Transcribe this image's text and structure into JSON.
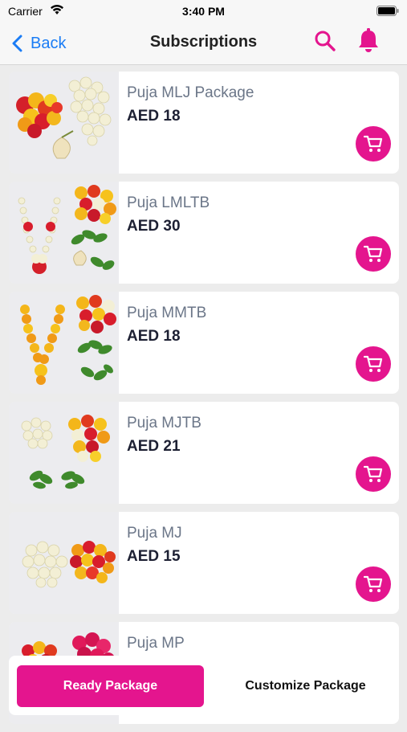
{
  "status_bar": {
    "carrier": "Carrier",
    "time": "3:40 PM",
    "icons": [
      "wifi-icon",
      "battery-icon"
    ]
  },
  "nav": {
    "back_label": "Back",
    "title": "Subscriptions",
    "icons": [
      "back-chevron-icon",
      "search-icon",
      "bell-icon"
    ]
  },
  "colors": {
    "accent": "#e4158e",
    "link": "#1a7cf5",
    "product_name": "#6b7688",
    "price": "#1d2033"
  },
  "products": [
    {
      "name": "Puja MLJ Package",
      "price": "AED 18",
      "image": "marigold-jasmine-lotus-bud"
    },
    {
      "name": "Puja LMLTB",
      "price": "AED 30",
      "image": "jasmine-garland-flowers-leaves"
    },
    {
      "name": "Puja MMTB",
      "price": "AED 18",
      "image": "marigold-garland-flowers-leaves"
    },
    {
      "name": "Puja MJTB",
      "price": "AED 21",
      "image": "jasmine-marigold-leaves"
    },
    {
      "name": "Puja MJ",
      "price": "AED 15",
      "image": "jasmine-marigold"
    },
    {
      "name": "Puja MP",
      "price": "",
      "image": "marigold-rose"
    }
  ],
  "bottom": {
    "ready_label": "Ready Package",
    "customize_label": "Customize Package"
  }
}
